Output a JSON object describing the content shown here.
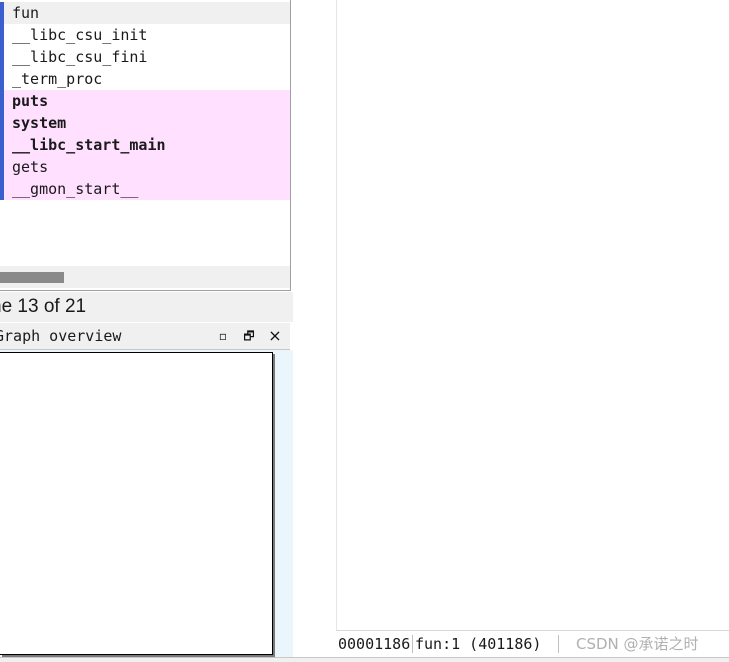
{
  "functions": {
    "items": [
      {
        "label": "fun",
        "selected": true,
        "import": false,
        "bold": false
      },
      {
        "label": "__libc_csu_init",
        "selected": false,
        "import": false,
        "bold": false
      },
      {
        "label": "__libc_csu_fini",
        "selected": false,
        "import": false,
        "bold": false
      },
      {
        "label": "_term_proc",
        "selected": false,
        "import": false,
        "bold": false
      },
      {
        "label": "puts",
        "selected": false,
        "import": true,
        "bold": true
      },
      {
        "label": "system",
        "selected": false,
        "import": true,
        "bold": true
      },
      {
        "label": "__libc_start_main",
        "selected": false,
        "import": true,
        "bold": true
      },
      {
        "label": "gets",
        "selected": false,
        "import": true,
        "bold": false
      },
      {
        "label": "__gmon_start__",
        "selected": false,
        "import": true,
        "bold": false
      }
    ]
  },
  "line_indicator": {
    "text": "ne 13 of 21"
  },
  "graph_overview": {
    "title": "Graph overview",
    "restore_glyph": "▫",
    "float_glyph": "🗗",
    "close_glyph": "×"
  },
  "status_bar": {
    "address": "00001186",
    "location": "fun:1 (401186)",
    "watermark": "CSDN @承诺之时"
  },
  "colors": {
    "import_highlight": "#ffe0ff",
    "selected_row": "#f0f0f0",
    "row_marker": "#3a5fcf",
    "graph_background": "#eaf6fb"
  }
}
